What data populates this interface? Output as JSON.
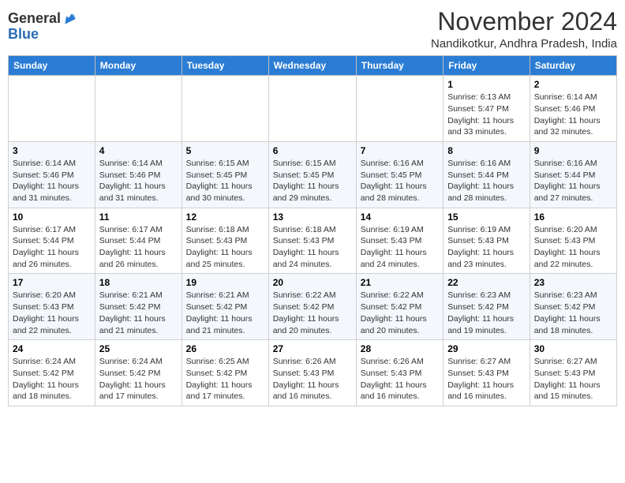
{
  "header": {
    "logo_line1": "General",
    "logo_line2": "Blue",
    "month": "November 2024",
    "location": "Nandikotkur, Andhra Pradesh, India"
  },
  "weekdays": [
    "Sunday",
    "Monday",
    "Tuesday",
    "Wednesday",
    "Thursday",
    "Friday",
    "Saturday"
  ],
  "weeks": [
    [
      {
        "day": "",
        "info": ""
      },
      {
        "day": "",
        "info": ""
      },
      {
        "day": "",
        "info": ""
      },
      {
        "day": "",
        "info": ""
      },
      {
        "day": "",
        "info": ""
      },
      {
        "day": "1",
        "info": "Sunrise: 6:13 AM\nSunset: 5:47 PM\nDaylight: 11 hours and 33 minutes."
      },
      {
        "day": "2",
        "info": "Sunrise: 6:14 AM\nSunset: 5:46 PM\nDaylight: 11 hours and 32 minutes."
      }
    ],
    [
      {
        "day": "3",
        "info": "Sunrise: 6:14 AM\nSunset: 5:46 PM\nDaylight: 11 hours and 31 minutes."
      },
      {
        "day": "4",
        "info": "Sunrise: 6:14 AM\nSunset: 5:46 PM\nDaylight: 11 hours and 31 minutes."
      },
      {
        "day": "5",
        "info": "Sunrise: 6:15 AM\nSunset: 5:45 PM\nDaylight: 11 hours and 30 minutes."
      },
      {
        "day": "6",
        "info": "Sunrise: 6:15 AM\nSunset: 5:45 PM\nDaylight: 11 hours and 29 minutes."
      },
      {
        "day": "7",
        "info": "Sunrise: 6:16 AM\nSunset: 5:45 PM\nDaylight: 11 hours and 28 minutes."
      },
      {
        "day": "8",
        "info": "Sunrise: 6:16 AM\nSunset: 5:44 PM\nDaylight: 11 hours and 28 minutes."
      },
      {
        "day": "9",
        "info": "Sunrise: 6:16 AM\nSunset: 5:44 PM\nDaylight: 11 hours and 27 minutes."
      }
    ],
    [
      {
        "day": "10",
        "info": "Sunrise: 6:17 AM\nSunset: 5:44 PM\nDaylight: 11 hours and 26 minutes."
      },
      {
        "day": "11",
        "info": "Sunrise: 6:17 AM\nSunset: 5:44 PM\nDaylight: 11 hours and 26 minutes."
      },
      {
        "day": "12",
        "info": "Sunrise: 6:18 AM\nSunset: 5:43 PM\nDaylight: 11 hours and 25 minutes."
      },
      {
        "day": "13",
        "info": "Sunrise: 6:18 AM\nSunset: 5:43 PM\nDaylight: 11 hours and 24 minutes."
      },
      {
        "day": "14",
        "info": "Sunrise: 6:19 AM\nSunset: 5:43 PM\nDaylight: 11 hours and 24 minutes."
      },
      {
        "day": "15",
        "info": "Sunrise: 6:19 AM\nSunset: 5:43 PM\nDaylight: 11 hours and 23 minutes."
      },
      {
        "day": "16",
        "info": "Sunrise: 6:20 AM\nSunset: 5:43 PM\nDaylight: 11 hours and 22 minutes."
      }
    ],
    [
      {
        "day": "17",
        "info": "Sunrise: 6:20 AM\nSunset: 5:43 PM\nDaylight: 11 hours and 22 minutes."
      },
      {
        "day": "18",
        "info": "Sunrise: 6:21 AM\nSunset: 5:42 PM\nDaylight: 11 hours and 21 minutes."
      },
      {
        "day": "19",
        "info": "Sunrise: 6:21 AM\nSunset: 5:42 PM\nDaylight: 11 hours and 21 minutes."
      },
      {
        "day": "20",
        "info": "Sunrise: 6:22 AM\nSunset: 5:42 PM\nDaylight: 11 hours and 20 minutes."
      },
      {
        "day": "21",
        "info": "Sunrise: 6:22 AM\nSunset: 5:42 PM\nDaylight: 11 hours and 20 minutes."
      },
      {
        "day": "22",
        "info": "Sunrise: 6:23 AM\nSunset: 5:42 PM\nDaylight: 11 hours and 19 minutes."
      },
      {
        "day": "23",
        "info": "Sunrise: 6:23 AM\nSunset: 5:42 PM\nDaylight: 11 hours and 18 minutes."
      }
    ],
    [
      {
        "day": "24",
        "info": "Sunrise: 6:24 AM\nSunset: 5:42 PM\nDaylight: 11 hours and 18 minutes."
      },
      {
        "day": "25",
        "info": "Sunrise: 6:24 AM\nSunset: 5:42 PM\nDaylight: 11 hours and 17 minutes."
      },
      {
        "day": "26",
        "info": "Sunrise: 6:25 AM\nSunset: 5:42 PM\nDaylight: 11 hours and 17 minutes."
      },
      {
        "day": "27",
        "info": "Sunrise: 6:26 AM\nSunset: 5:43 PM\nDaylight: 11 hours and 16 minutes."
      },
      {
        "day": "28",
        "info": "Sunrise: 6:26 AM\nSunset: 5:43 PM\nDaylight: 11 hours and 16 minutes."
      },
      {
        "day": "29",
        "info": "Sunrise: 6:27 AM\nSunset: 5:43 PM\nDaylight: 11 hours and 16 minutes."
      },
      {
        "day": "30",
        "info": "Sunrise: 6:27 AM\nSunset: 5:43 PM\nDaylight: 11 hours and 15 minutes."
      }
    ]
  ]
}
